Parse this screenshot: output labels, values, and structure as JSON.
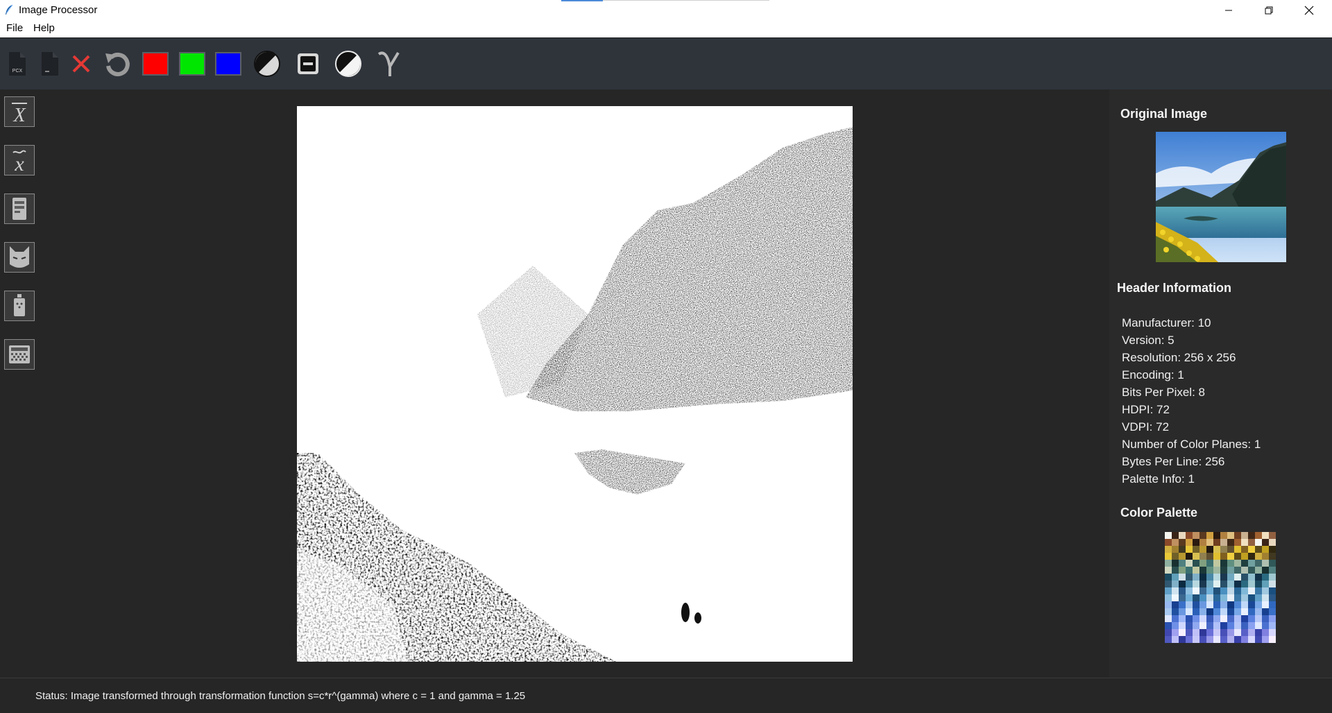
{
  "window": {
    "title": "Image Processor",
    "controls": [
      "minimize",
      "restore",
      "close"
    ]
  },
  "menu": {
    "file": "File",
    "help": "Help"
  },
  "toolbar": {
    "tools": [
      {
        "name": "open-pcx-icon",
        "label": "PCX"
      },
      {
        "name": "save-file-icon"
      },
      {
        "name": "close-icon"
      },
      {
        "name": "reset-icon"
      },
      {
        "name": "red-channel-swatch",
        "color": "#ff0000"
      },
      {
        "name": "green-channel-swatch",
        "color": "#00e600"
      },
      {
        "name": "blue-channel-swatch",
        "color": "#0000ff"
      },
      {
        "name": "grayscale-icon"
      },
      {
        "name": "threshold-icon"
      },
      {
        "name": "negative-icon"
      },
      {
        "name": "gamma-icon"
      }
    ]
  },
  "sidebar": {
    "tools": [
      {
        "name": "mean-filter-icon",
        "symbol": "X"
      },
      {
        "name": "median-filter-icon",
        "symbol": "x"
      },
      {
        "name": "histogram-equalize-icon"
      },
      {
        "name": "cat-filter-icon"
      },
      {
        "name": "salt-pepper-icon"
      },
      {
        "name": "noise-pattern-icon"
      }
    ]
  },
  "panel": {
    "original_heading": "Original Image",
    "header_heading": "Header Information",
    "header_lines": [
      "Manufacturer: 10",
      "Version: 5",
      "Resolution: 256 x 256",
      "Encoding: 1",
      "Bits Per Pixel: 8",
      "HDPI: 72",
      "VDPI: 72",
      "Number of Color Planes: 1",
      "Bytes Per Line: 256",
      "Palette Info: 1"
    ],
    "palette_heading": "Color Palette"
  },
  "status": {
    "text": "Status: Image transformed through transformation function s=c*r^(gamma) where c = 1 and gamma = 1.25"
  },
  "colors": {
    "toolbar_bg": "#2f343b",
    "window_bg": "#262626",
    "panel_bg": "#2a2a2a",
    "close_red": "#e53935"
  }
}
